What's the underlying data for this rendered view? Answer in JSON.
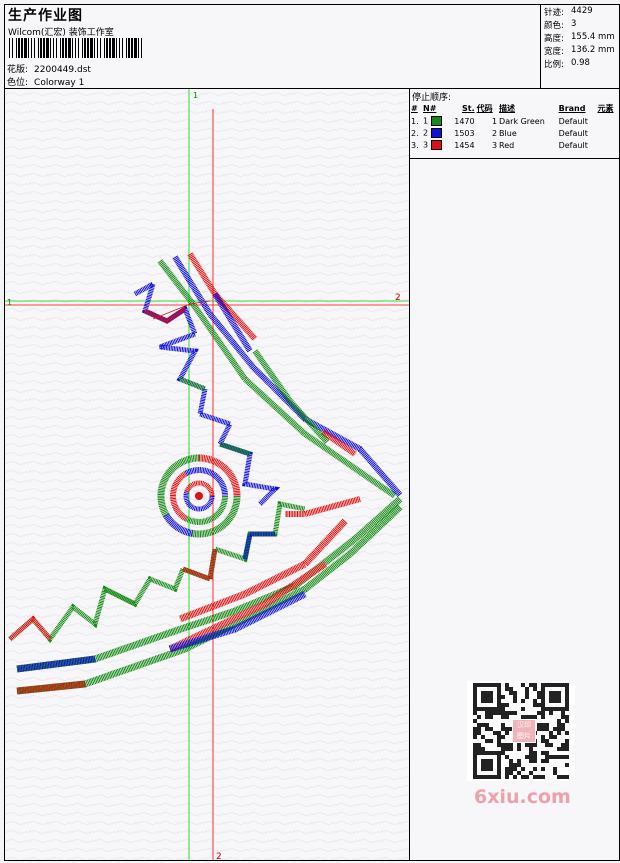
{
  "header": {
    "title": "生产作业图",
    "company": "Wilcom(汇宏) 装饰工作室",
    "design_label": "花版:",
    "design_value": "2200449.dst",
    "colorway_label": "色位:",
    "colorway_value": "Colorway 1"
  },
  "specs": [
    {
      "label": "针迹:",
      "value": "4429"
    },
    {
      "label": "颜色:",
      "value": "3"
    },
    {
      "label": "高度:",
      "value": "155.4 mm"
    },
    {
      "label": "宽度:",
      "value": "136.2 mm"
    },
    {
      "label": "比例:",
      "value": "0.98"
    }
  ],
  "stop_sequence": {
    "title": "停止顺序:",
    "columns": [
      "#",
      "N#",
      "St.",
      "代码",
      "描述",
      "Brand",
      "元素"
    ],
    "rows": [
      {
        "num": "1.",
        "n": "1",
        "color": "#138a13",
        "st": "1470",
        "code": "1",
        "desc": "Dark Green",
        "brand": "Default"
      },
      {
        "num": "2.",
        "n": "2",
        "color": "#1010d8",
        "st": "1503",
        "code": "2",
        "desc": "Blue",
        "brand": "Default"
      },
      {
        "num": "3.",
        "n": "3",
        "color": "#e01010",
        "st": "1454",
        "code": "3",
        "desc": "Red",
        "brand": "Default"
      }
    ]
  },
  "guides": {
    "v_green_label": "1",
    "h_green_label": "1",
    "h_red_label": "2",
    "v_red_label": "2"
  },
  "watermark": {
    "text": "6xiu.com",
    "qr_logo": "汉印 图片"
  },
  "colors": {
    "green": "#138a13",
    "blue": "#1010d8",
    "red": "#e01010",
    "guide_green": "#00d000",
    "guide_red": "#ff0000"
  }
}
